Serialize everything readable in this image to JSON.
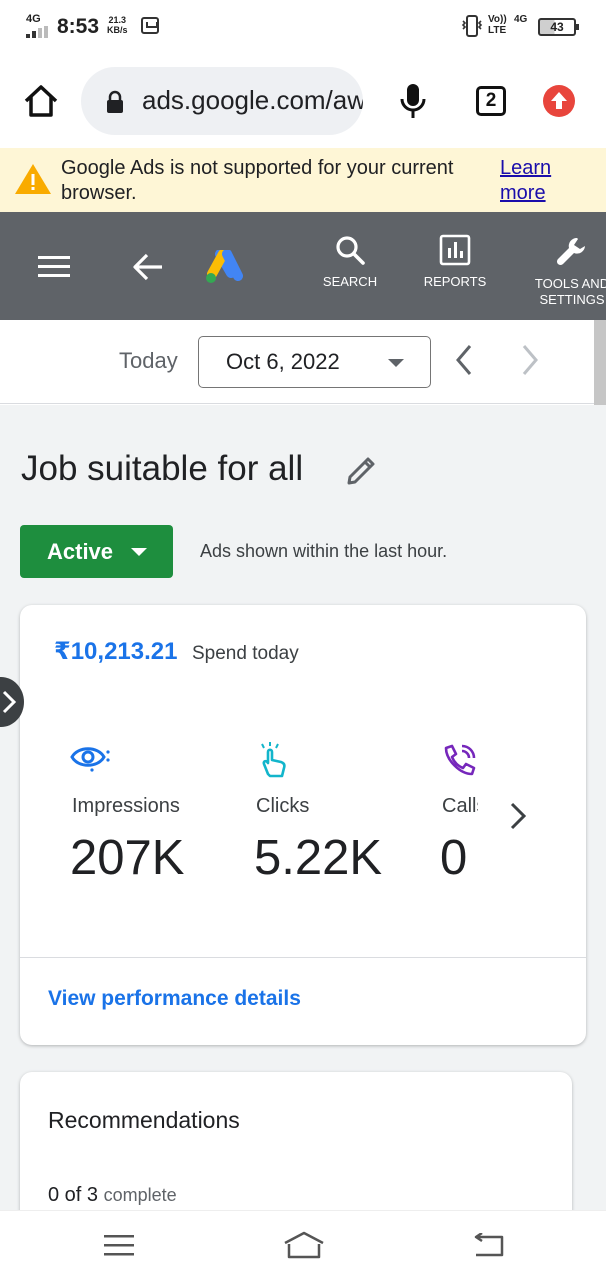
{
  "status_bar": {
    "network": "4G",
    "time": "8:53",
    "speed_value": "21.3",
    "speed_unit": "KB/s",
    "volte": "Vo)) LTE",
    "network_right": "4G",
    "battery": "43"
  },
  "browser": {
    "url": "ads.google.com/aw",
    "tab_count": "2"
  },
  "banner": {
    "message": "Google Ads is not supported for your current browser.",
    "link_line1": "Learn",
    "link_line2": "more"
  },
  "app_header": {
    "search_label": "SEARCH",
    "reports_label": "REPORTS",
    "tools_label_line1": "TOOLS AND",
    "tools_label_line2": "SETTINGS"
  },
  "date_row": {
    "range_label": "Today",
    "date_value": "Oct 6, 2022"
  },
  "campaign": {
    "title": "Job suitable for all",
    "status": "Active",
    "status_note": "Ads shown within the last hour."
  },
  "performance": {
    "spend_amount": "₹10,213.21",
    "spend_label": "Spend today",
    "metrics": [
      {
        "label": "Impressions",
        "value": "207K",
        "icon": "impressions-eye-icon"
      },
      {
        "label": "Clicks",
        "value": "5.22K",
        "icon": "click-hand-icon"
      },
      {
        "label": "Calls",
        "value": "0",
        "icon": "phone-call-icon"
      }
    ],
    "details_link": "View performance details"
  },
  "recommendations": {
    "title": "Recommendations",
    "done": "0 of 3",
    "done_suffix": "complete"
  },
  "colors": {
    "header_gray": "#5f6368",
    "banner_yellow": "#fef6d6",
    "active_green": "#1e8e3e",
    "link_blue": "#1a73e8"
  }
}
